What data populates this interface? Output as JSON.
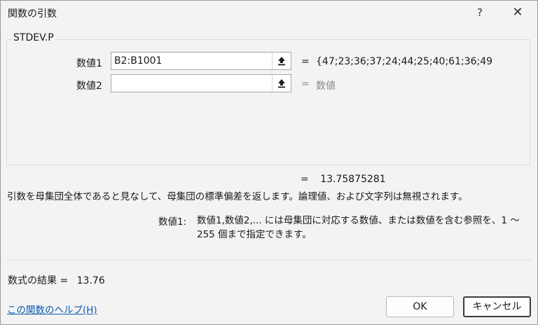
{
  "window": {
    "title": "関数の引数",
    "help_label": "?",
    "close_label": "✕"
  },
  "function_name": "STDEV.P",
  "args": [
    {
      "label": "数値1",
      "value": "B2:B1001",
      "result": "{47;23;36;37;24;44;25;40;61;36;49"
    },
    {
      "label": "数値2",
      "value": "",
      "result": "数値"
    }
  ],
  "equals": "=",
  "formula_result": "13.75875281",
  "description": "引数を母集団全体であると見なして、母集団の標準偏差を返します。論理値、および文字列は無視されます。",
  "arg_help": {
    "name": "数値1:",
    "text": "数値1,数値2,... には母集団に対応する数値、または数値を含む参照を、1 ～ 255 個まで指定できます。"
  },
  "final_result": {
    "label": "数式の結果 =",
    "value": "13.76"
  },
  "help_link": "この関数のヘルプ(H)",
  "buttons": {
    "ok": "OK",
    "cancel": "キャンセル"
  },
  "icons": {
    "collapse": "collapse-dialog-icon",
    "help": "question-icon",
    "close": "close-icon"
  }
}
